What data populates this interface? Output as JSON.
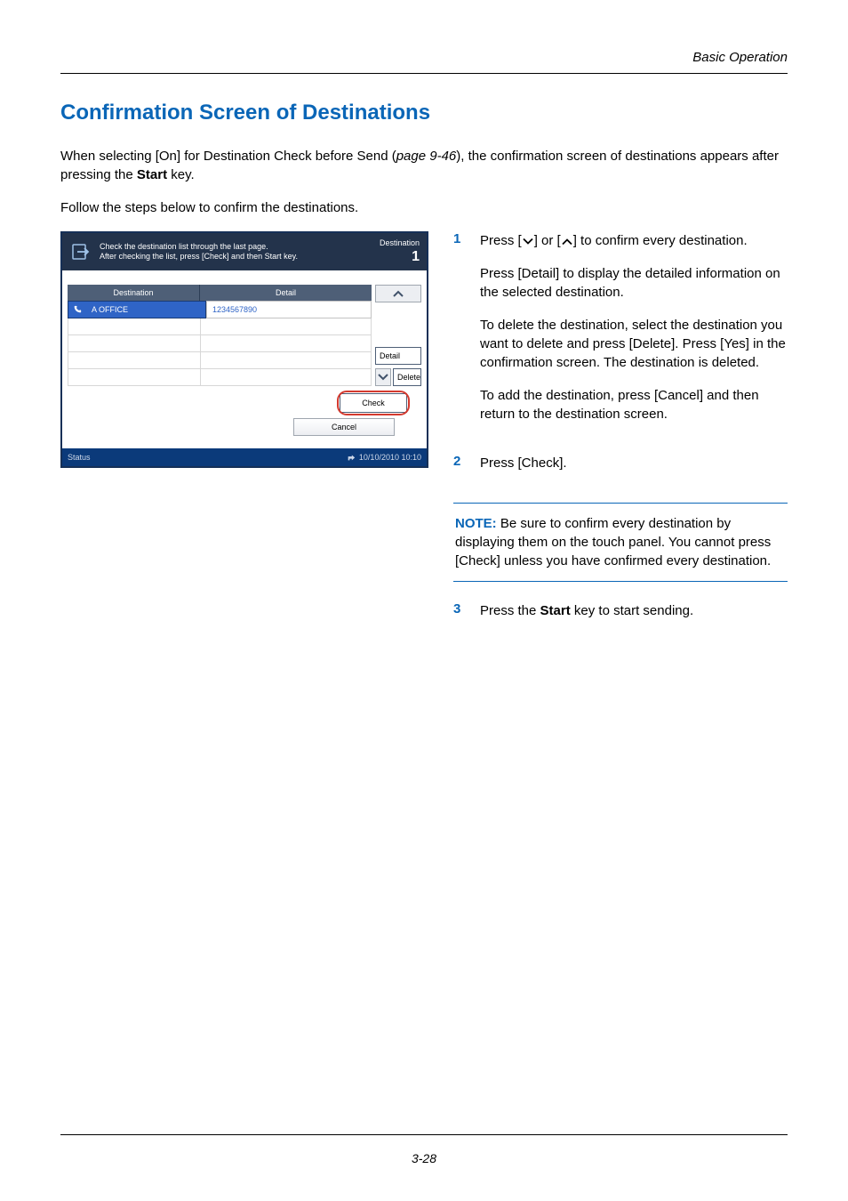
{
  "header": {
    "running": "Basic Operation"
  },
  "title": "Confirmation Screen of Destinations",
  "intro1_a": "When selecting [On] for Destination Check before Send (",
  "intro1_b": "page 9-46",
  "intro1_c": "), the confirmation screen of destinations appears after pressing the ",
  "intro1_d": "Start",
  "intro1_e": " key.",
  "intro2": "Follow the steps below to confirm the destinations.",
  "screen": {
    "help1": "Check the destination list through the last page.",
    "help2": "After checking the list, press [Check] and then Start key.",
    "counter_label": "Destination",
    "counter_value": "1",
    "col_destination": "Destination",
    "col_detail": "Detail",
    "row_dest": "A OFFICE",
    "row_detail": "1234567890",
    "btn_detail": "Detail",
    "btn_delete": "Delete",
    "btn_check": "Check",
    "btn_cancel": "Cancel",
    "status_label": "Status",
    "status_ts": "10/10/2010  10:10"
  },
  "steps": {
    "s1_num": "1",
    "s1_line1a": "Press [",
    "s1_line1b": "] or [",
    "s1_line1c": "] to confirm every destination.",
    "s1_p2": "Press [Detail] to display the detailed information on the selected destination.",
    "s1_p3": "To delete the destination, select the destination you want to delete and press [Delete]. Press [Yes] in the confirmation screen. The destination is deleted.",
    "s1_p4": "To add the destination, press [Cancel] and then return to the destination screen.",
    "s2_num": "2",
    "s2_text": "Press [Check].",
    "s3_num": "3",
    "s3_a": "Press the ",
    "s3_b": "Start",
    "s3_c": " key to start sending."
  },
  "note": {
    "label": "NOTE:",
    "text": " Be sure to confirm every destination by displaying them on the touch panel. You cannot press [Check] unless you have confirmed every destination."
  },
  "footer": {
    "page": "3-28"
  }
}
